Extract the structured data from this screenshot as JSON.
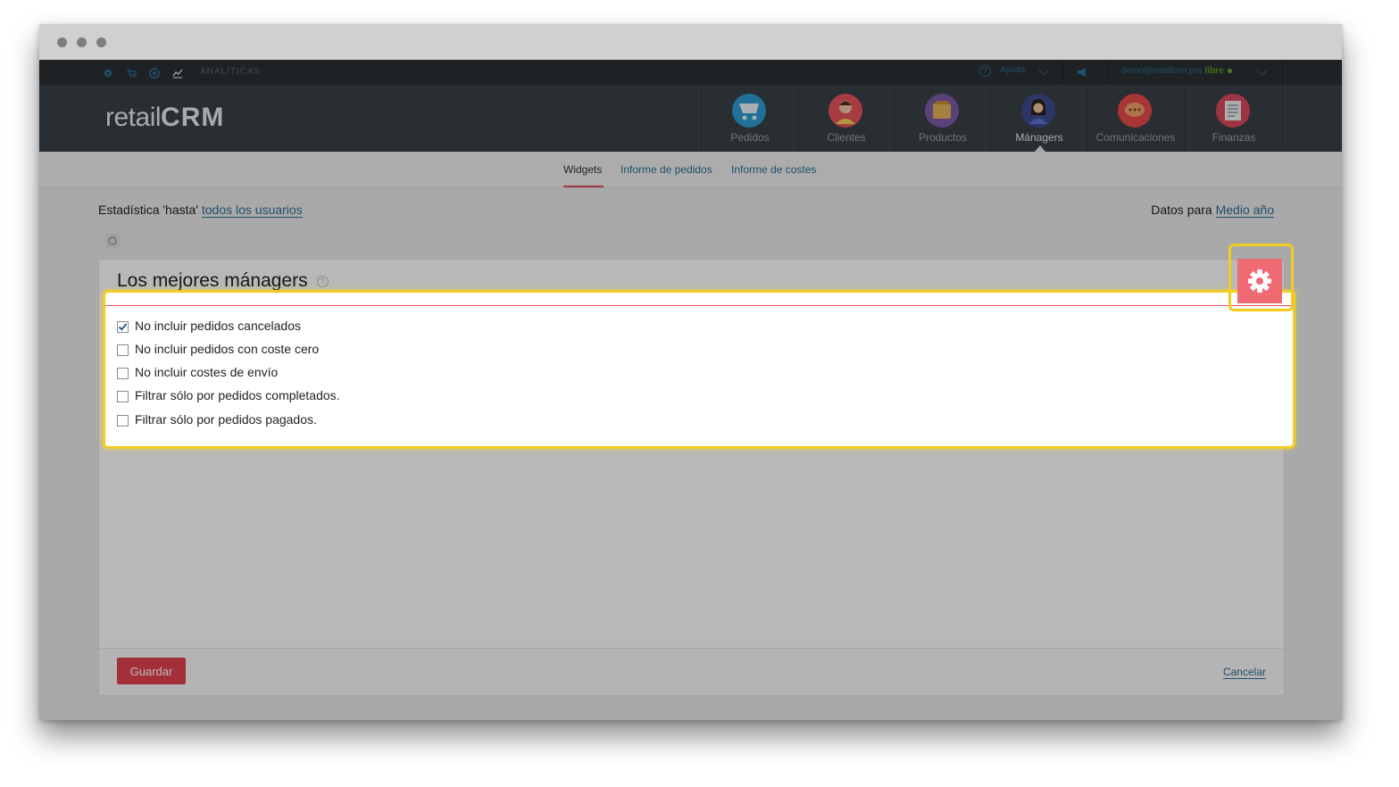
{
  "topbar": {
    "section_label": "ANALÍTICAS",
    "help_label": "Ayuda",
    "help_icon_glyph": "?",
    "user_email": "demo@retailcrm.pro",
    "plan_label": "libre"
  },
  "logo": {
    "part1": "retail",
    "part2": "CRM"
  },
  "nav": [
    {
      "label": "Pedidos",
      "icon": "cart-icon",
      "color": "#2f9bd1"
    },
    {
      "label": "Clientes",
      "icon": "customer-icon",
      "color": "#e9545d"
    },
    {
      "label": "Productos",
      "icon": "box-icon",
      "color": "#7f5aa8"
    },
    {
      "label": "Mánagers",
      "icon": "manager-icon",
      "color": "#3f4d8f"
    },
    {
      "label": "Comunicaciones",
      "icon": "chat-icon",
      "color": "#e84a4a"
    },
    {
      "label": "Finanzas",
      "icon": "ledger-icon",
      "color": "#d8485c"
    }
  ],
  "subnav": {
    "widgets": "Widgets",
    "orders_report": "Informe de pedidos",
    "costs_report": "Informe de costes"
  },
  "stats": {
    "prefix": "Estadística 'hasta'",
    "users_link": "todos los usuarios",
    "data_prefix": "Datos para",
    "period_link": "Medio año"
  },
  "card": {
    "title": "Los mejores mánagers",
    "help_glyph": "?",
    "save_label": "Guardar",
    "cancel_label": "Cancelar"
  },
  "options": [
    {
      "label": "No incluir pedidos cancelados",
      "checked": true
    },
    {
      "label": "No incluir pedidos con coste cero",
      "checked": false
    },
    {
      "label": "No incluir costes de envío",
      "checked": false
    },
    {
      "label": "Filtrar sólo por pedidos completados.",
      "checked": false
    },
    {
      "label": "Filtrar sólo por pedidos pagados.",
      "checked": false
    }
  ],
  "colors": {
    "accent_red": "#e2434f",
    "highlight_yellow": "#f2cd1f",
    "link_blue": "#2a6f95",
    "header_dark": "#384046"
  }
}
